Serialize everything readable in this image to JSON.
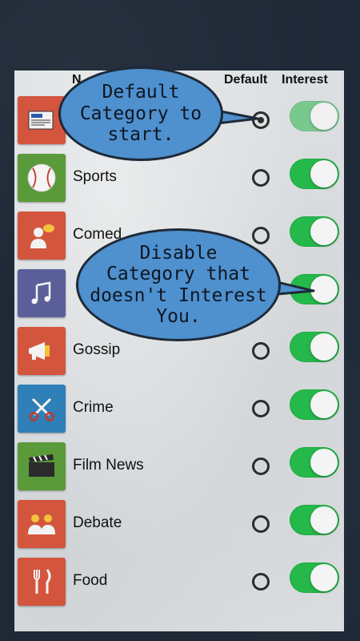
{
  "header": {
    "name_label": "N",
    "default_label": "Default",
    "interest_label": "Interest"
  },
  "categories": [
    {
      "label": "",
      "icon": "newspaper-icon",
      "color": "#d4553e",
      "default": true,
      "interest": true
    },
    {
      "label": "Sports",
      "icon": "baseball-icon",
      "color": "#5a9a3a",
      "default": false,
      "interest": true
    },
    {
      "label": "Comed",
      "icon": "comedy-person-icon",
      "color": "#d4553e",
      "default": false,
      "interest": true
    },
    {
      "label": "",
      "icon": "music-note-icon",
      "color": "#5a5f9a",
      "default": false,
      "interest": true
    },
    {
      "label": "Gossip",
      "icon": "megaphone-icon",
      "color": "#d4553e",
      "default": false,
      "interest": true
    },
    {
      "label": "Crime",
      "icon": "scissors-icon",
      "color": "#2f7fb8",
      "default": false,
      "interest": true
    },
    {
      "label": "Film News",
      "icon": "clapperboard-icon",
      "color": "#5a9a3a",
      "default": false,
      "interest": true
    },
    {
      "label": "Debate",
      "icon": "people-icon",
      "color": "#d4553e",
      "default": false,
      "interest": true
    },
    {
      "label": "Food",
      "icon": "fork-knife-icon",
      "color": "#d4553e",
      "default": false,
      "interest": true
    }
  ],
  "callouts": {
    "default_hint": "Default\nCategory to\nstart.",
    "disable_hint": "Disable\nCategory that\ndoesn't Interest\nYou."
  }
}
